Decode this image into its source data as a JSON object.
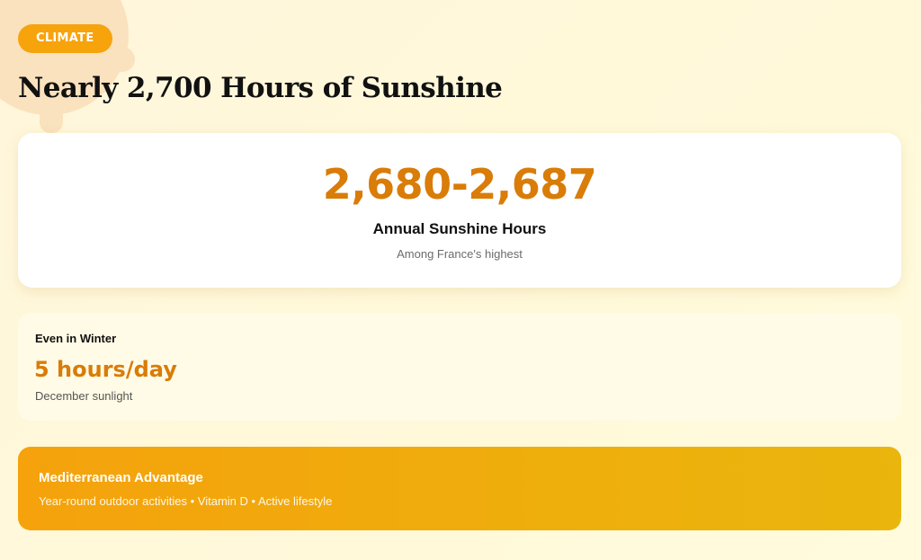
{
  "header": {
    "tag": "CLIMATE",
    "title": "Nearly 2,700 Hours of Sunshine"
  },
  "hero": {
    "value": "2,680-2,687",
    "label": "Annual Sunshine Hours",
    "sub": "Among France's highest"
  },
  "winter": {
    "heading": "Even in Winter",
    "value": "5 hours/day",
    "sub": "December sunlight"
  },
  "advantage": {
    "title": "Mediterranean Advantage",
    "sub": "Year-round outdoor activities • Vitamin D • Active lifestyle"
  },
  "colors": {
    "accent": "#f7a30c",
    "value_text": "#d97c08",
    "decor": "#f9e2bd"
  }
}
